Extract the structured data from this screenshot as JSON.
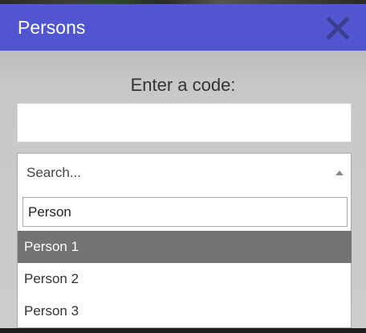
{
  "dialog": {
    "title": "Persons",
    "close_icon": "close-x-icon",
    "prompt": "Enter a code:",
    "code_input": {
      "value": "",
      "placeholder": ""
    }
  },
  "select": {
    "placeholder": "Search...",
    "search_value": "Person",
    "options": [
      {
        "label": "Person 1",
        "highlighted": true
      },
      {
        "label": "Person 2",
        "highlighted": false
      },
      {
        "label": "Person 3",
        "highlighted": false
      }
    ]
  },
  "colors": {
    "titlebar": "#5156d0",
    "highlight": "#737373"
  }
}
